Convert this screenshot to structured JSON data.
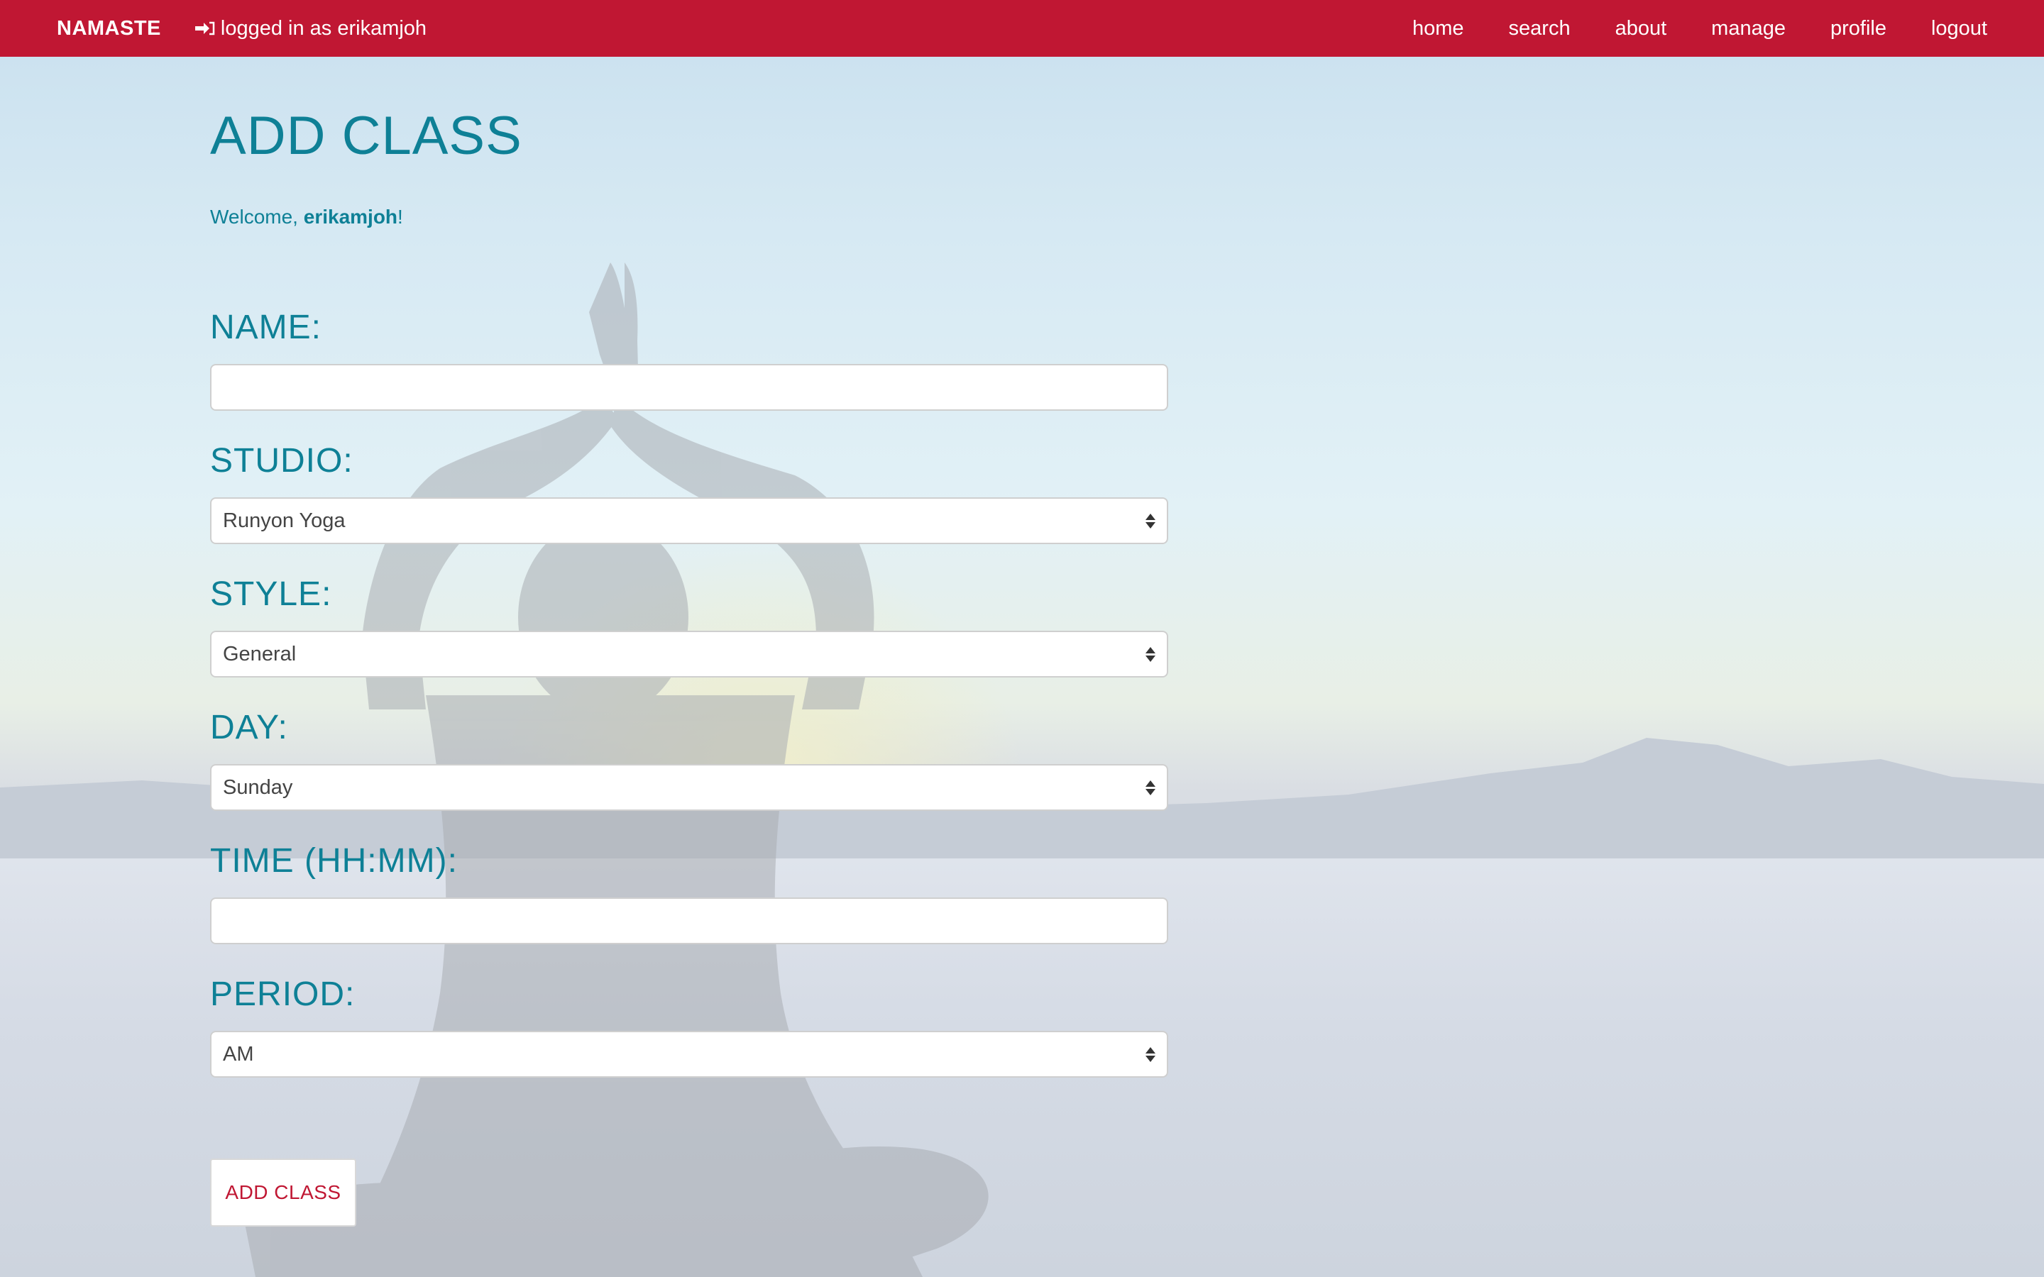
{
  "navbar": {
    "brand": "NAMASTE",
    "login_text": "logged in as erikamjoh",
    "login_icon": "sign-in-icon",
    "links": [
      "home",
      "search",
      "about",
      "manage",
      "profile",
      "logout"
    ],
    "color": "#c01733"
  },
  "page": {
    "title": "ADD CLASS",
    "welcome_prefix": "Welcome, ",
    "welcome_user": "erikamjoh",
    "welcome_suffix": "!"
  },
  "form": {
    "name": {
      "label": "NAME:",
      "value": ""
    },
    "studio": {
      "label": "STUDIO:",
      "value": "Runyon Yoga"
    },
    "style": {
      "label": "STYLE:",
      "value": "General"
    },
    "day": {
      "label": "DAY:",
      "value": "Sunday"
    },
    "time": {
      "label": "TIME (HH:MM):",
      "value": ""
    },
    "period": {
      "label": "PERIOD:",
      "value": "AM"
    },
    "submit_label": "ADD CLASS"
  },
  "colors": {
    "accent": "#0e8096",
    "brand": "#c01733"
  }
}
